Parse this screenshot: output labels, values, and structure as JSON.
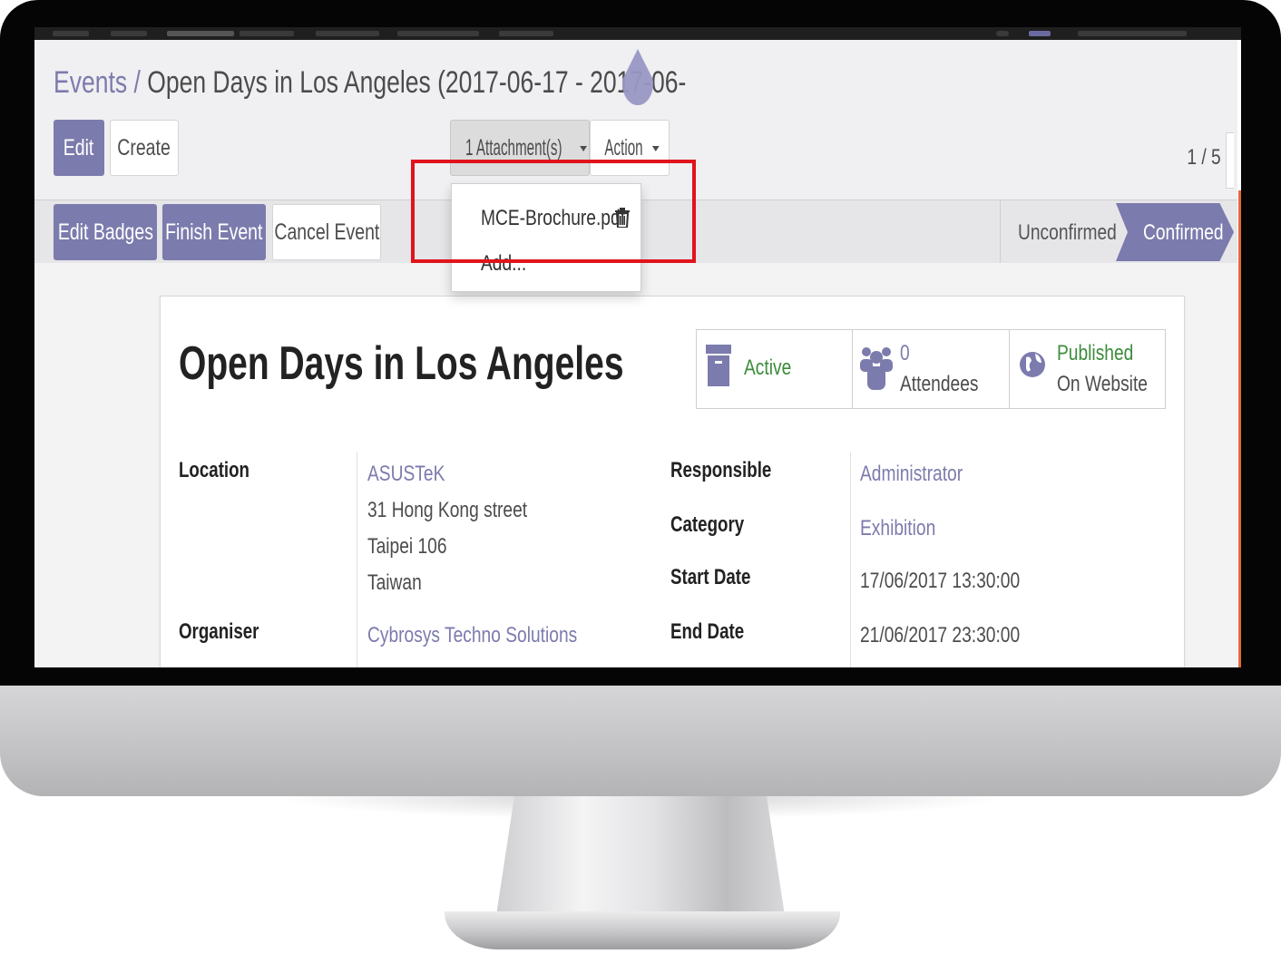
{
  "breadcrumb": {
    "parent": "Events /",
    "current": "Open Days in Los Angeles (2017-06-17 - 2017-06-"
  },
  "buttons": {
    "edit": "Edit",
    "create": "Create",
    "attachments": "1 Attachment(s)",
    "action": "Action"
  },
  "pager": "1 / 5",
  "header_buttons": {
    "edit_badges": "Edit Badges",
    "finish_event": "Finish Event",
    "cancel_event": "Cancel Event"
  },
  "status": {
    "unconfirmed": "Unconfirmed",
    "confirmed": "Confirmed"
  },
  "attachments_menu": {
    "file": "MCE-Brochure.pdf",
    "add": "Add..."
  },
  "record": {
    "title": "Open Days in Los Angeles",
    "smart_buttons": {
      "active": "Active",
      "attendees_count": "0",
      "attendees_label": "Attendees",
      "published": "Published",
      "on_website": "On Website"
    },
    "labels": {
      "location": "Location",
      "organiser": "Organiser",
      "responsible": "Responsible",
      "category": "Category",
      "start_date": "Start Date",
      "end_date": "End Date"
    },
    "values": {
      "location_name": "ASUSTeK",
      "address_1": "31 Hong Kong street",
      "address_2": "Taipei 106",
      "address_3": "Taiwan",
      "organiser": "Cybrosys Techno Solutions",
      "responsible": "Administrator",
      "category": "Exhibition",
      "start_date": "17/06/2017 13:30:00",
      "end_date": "21/06/2017 23:30:00"
    }
  },
  "colors": {
    "brand": "#7c7bad",
    "highlight": "#e0141c",
    "active_green": "#3c8c3c"
  }
}
